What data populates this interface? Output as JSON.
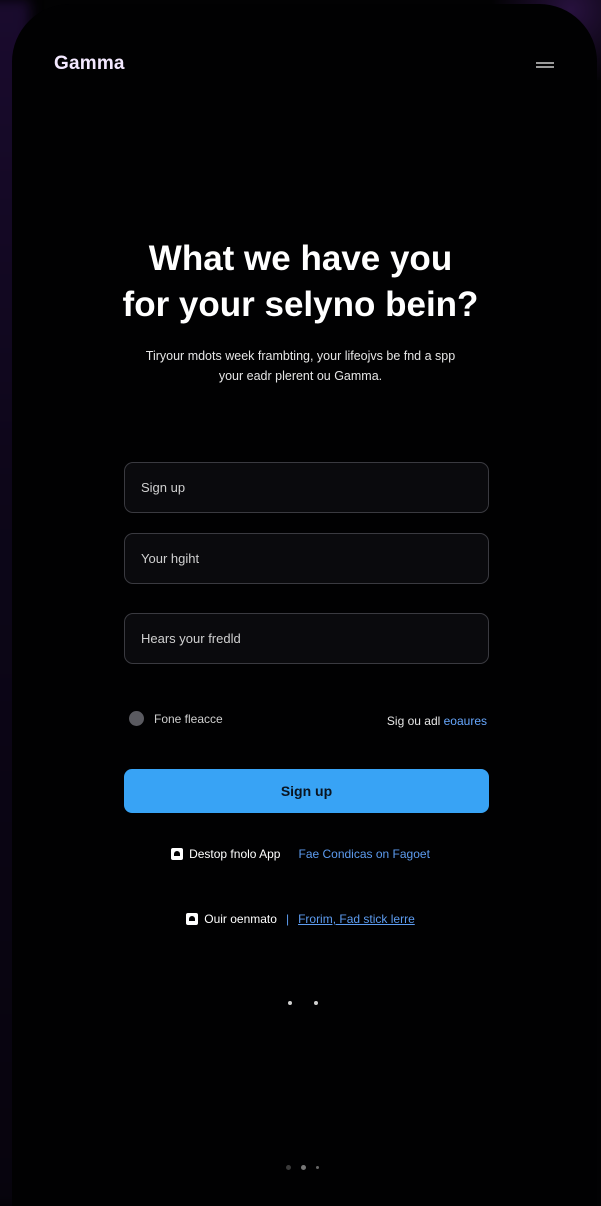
{
  "app": {
    "name": "Gamma"
  },
  "header": {
    "menu_icon": "hamburger-menu-icon"
  },
  "hero": {
    "title_line1": "What we have you",
    "title_line2": "for your selyno bein?",
    "subtitle_line1": "Tiryour mdots week frambting, your lifeojvs be fnd a spp",
    "subtitle_line2": "your eadr plerent ou Gamma."
  },
  "form": {
    "field1_placeholder": "Sign up",
    "field2_placeholder": "Your hgiht",
    "field3_placeholder": "Hears your fredld",
    "remember_label": "Fone fleacce",
    "signin_prefix": "Sig ou adl",
    "signin_link": "eoaures",
    "submit_label": "Sign up"
  },
  "links": {
    "row1_label": "Destop fnolo App",
    "row1_link": "Fae Condicas on Fagoet",
    "row2_label": "Ouir oenmato",
    "row2_link": "Frorim, Fad stick lerre"
  },
  "colors": {
    "accent": "#38a3f5",
    "link": "#67a8ff",
    "background": "#020203"
  }
}
